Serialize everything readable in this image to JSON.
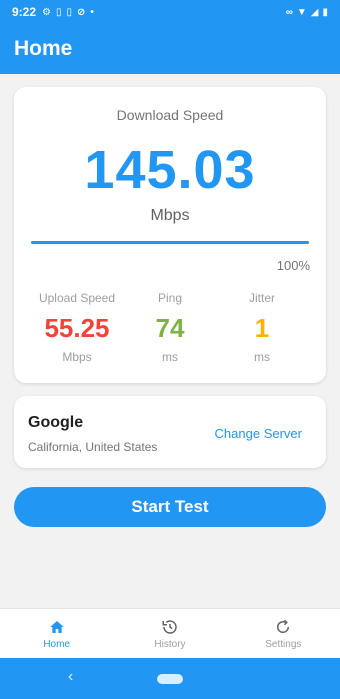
{
  "status_bar": {
    "time": "9:22",
    "icons_left": [
      "gear-icon",
      "sim-icon",
      "sim-icon",
      "sync-icon",
      "dot-icon"
    ],
    "icons_right": [
      "link-icon",
      "wifi-icon",
      "signal-icon",
      "battery-icon"
    ]
  },
  "app_bar": {
    "title": "Home"
  },
  "speed_card": {
    "download_label": "Download Speed",
    "download_value": "145.03",
    "download_unit": "Mbps",
    "progress_percent": 100,
    "progress_label": "100%",
    "metrics": [
      {
        "label": "Upload Speed",
        "value": "55.25",
        "unit": "Mbps",
        "color": "#f44336"
      },
      {
        "label": "Ping",
        "value": "74",
        "unit": "ms",
        "color": "#7cb342"
      },
      {
        "label": "Jitter",
        "value": "1",
        "unit": "ms",
        "color": "#ffb300"
      }
    ]
  },
  "server_card": {
    "name": "Google",
    "location": "California, United States",
    "change_label": "Change Server"
  },
  "start_button": {
    "label": "Start Test"
  },
  "bottom_nav": {
    "items": [
      {
        "label": "Home",
        "icon": "home-icon",
        "active": true
      },
      {
        "label": "History",
        "icon": "history-icon",
        "active": false
      },
      {
        "label": "Settings",
        "icon": "refresh-icon",
        "active": false
      }
    ]
  },
  "colors": {
    "primary": "#2196f3",
    "upload": "#f44336",
    "ping": "#7cb342",
    "jitter": "#ffb300"
  }
}
